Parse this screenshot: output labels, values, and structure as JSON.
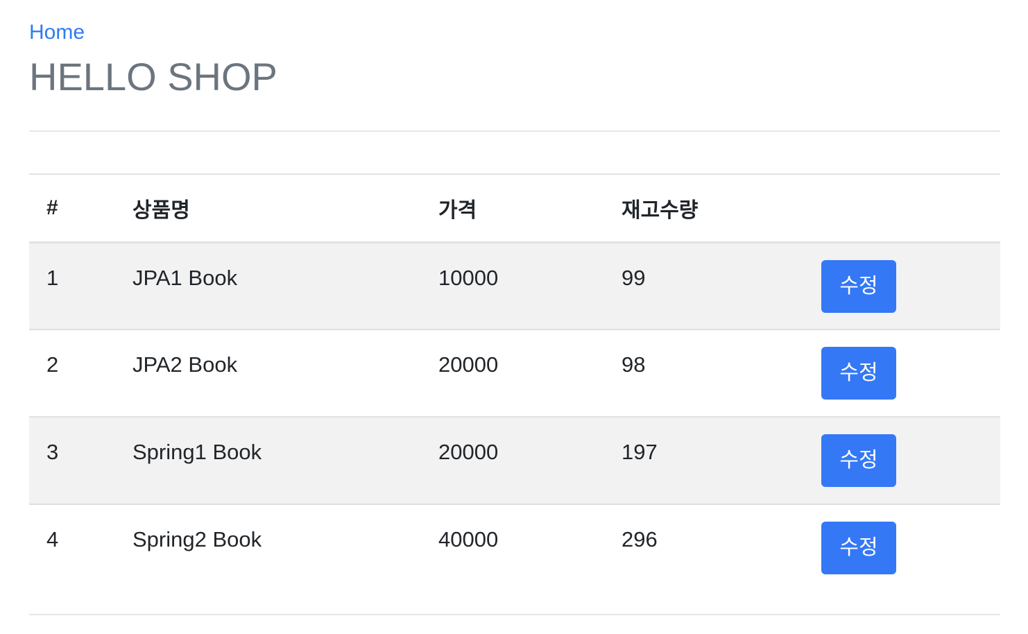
{
  "nav": {
    "home_label": "Home"
  },
  "header": {
    "title": "HELLO SHOP"
  },
  "table": {
    "columns": {
      "id": "#",
      "name": "상품명",
      "price": "가격",
      "stock": "재고수량",
      "action": ""
    },
    "rows": [
      {
        "id": "1",
        "name": "JPA1 Book",
        "price": "10000",
        "stock": "99",
        "action_label": "수정"
      },
      {
        "id": "2",
        "name": "JPA2 Book",
        "price": "20000",
        "stock": "98",
        "action_label": "수정"
      },
      {
        "id": "3",
        "name": "Spring1 Book",
        "price": "20000",
        "stock": "197",
        "action_label": "수정"
      },
      {
        "id": "4",
        "name": "Spring2 Book",
        "price": "40000",
        "stock": "296",
        "action_label": "수정"
      }
    ]
  },
  "colors": {
    "link": "#2f7bf0",
    "title": "#6c757d",
    "button": "#3478f6",
    "stripe": "#f2f2f2"
  }
}
